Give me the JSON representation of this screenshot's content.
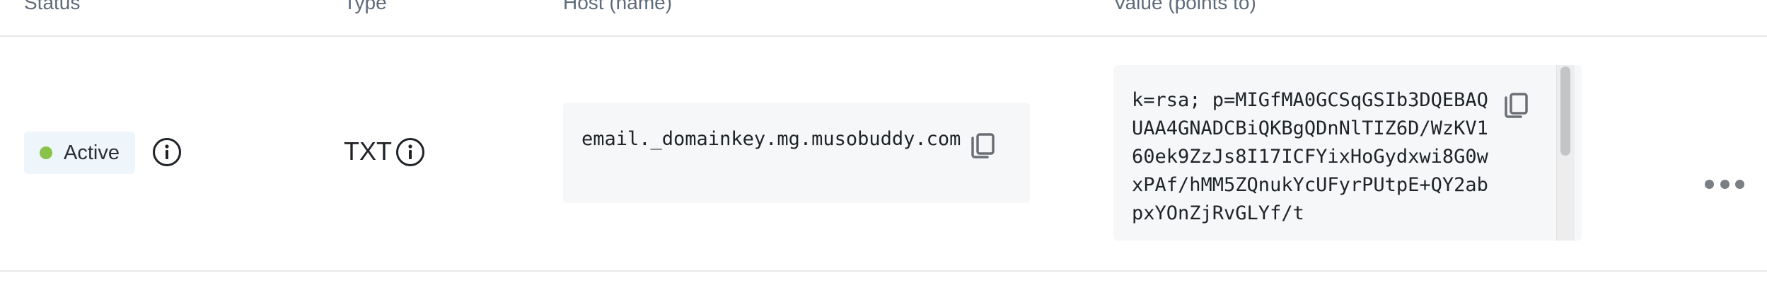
{
  "table": {
    "headers": {
      "status": "Status",
      "type": "Type",
      "host": "Host (name)",
      "value": "Value (points to)"
    },
    "rows": [
      {
        "status": "Active",
        "status_color": "#8bc34a",
        "type": "TXT",
        "host": "email._domainkey.mg.musobuddy.com",
        "value": "k=rsa; p=MIGfMA0GCSqGSIb3DQEBAQUAA4GNADCBiQKBgQDnNlTIZ6D/WzKV160ek9ZzJs8I17ICFYixHoGydxwi8G0wxPAf/hMM5ZQnukYcUFyrPUtpE+QY2abpxYOnZjRvGLYf/t"
      }
    ]
  },
  "icons": {
    "status_info": "info-icon",
    "type_info": "info-icon",
    "host_copy": "copy-icon",
    "value_copy": "copy-icon",
    "row_menu": "more-horizontal-icon"
  }
}
